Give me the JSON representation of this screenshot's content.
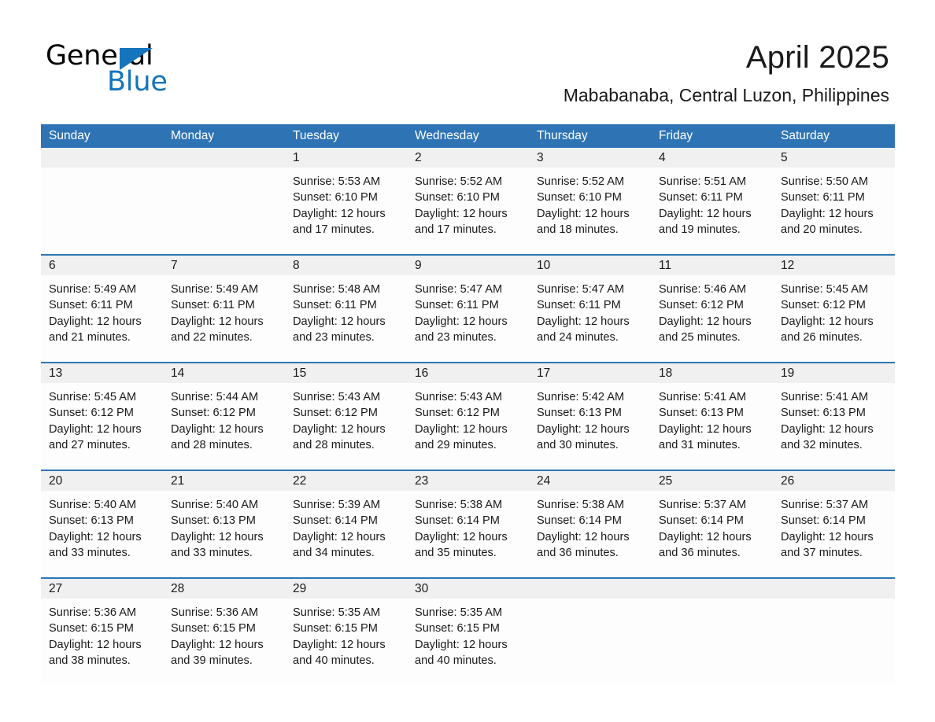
{
  "brand": {
    "name_part1": "General",
    "name_part2": "Blue",
    "triangle_icon": "blue-triangle-icon",
    "colors": {
      "black": "#000000",
      "blue": "#1474bc"
    }
  },
  "header": {
    "title": "April 2025",
    "subtitle": "Mababanaba, Central Luzon, Philippines"
  },
  "theme": {
    "header_blue": "#2e74b5",
    "date_band_gray": "#f0f0f0",
    "cell_background": "#fdfdfd",
    "text_color": "#1a1a1a"
  },
  "weekday_headers": [
    "Sunday",
    "Monday",
    "Tuesday",
    "Wednesday",
    "Thursday",
    "Friday",
    "Saturday"
  ],
  "weeks": [
    {
      "days": [
        {
          "num": "",
          "empty": true,
          "sunrise": "",
          "sunset": "",
          "daylight_1": "",
          "daylight_2": ""
        },
        {
          "num": "",
          "empty": true,
          "sunrise": "",
          "sunset": "",
          "daylight_1": "",
          "daylight_2": ""
        },
        {
          "num": "1",
          "empty": false,
          "sunrise": "Sunrise: 5:53 AM",
          "sunset": "Sunset: 6:10 PM",
          "daylight_1": "Daylight: 12 hours",
          "daylight_2": "and 17 minutes."
        },
        {
          "num": "2",
          "empty": false,
          "sunrise": "Sunrise: 5:52 AM",
          "sunset": "Sunset: 6:10 PM",
          "daylight_1": "Daylight: 12 hours",
          "daylight_2": "and 17 minutes."
        },
        {
          "num": "3",
          "empty": false,
          "sunrise": "Sunrise: 5:52 AM",
          "sunset": "Sunset: 6:10 PM",
          "daylight_1": "Daylight: 12 hours",
          "daylight_2": "and 18 minutes."
        },
        {
          "num": "4",
          "empty": false,
          "sunrise": "Sunrise: 5:51 AM",
          "sunset": "Sunset: 6:11 PM",
          "daylight_1": "Daylight: 12 hours",
          "daylight_2": "and 19 minutes."
        },
        {
          "num": "5",
          "empty": false,
          "sunrise": "Sunrise: 5:50 AM",
          "sunset": "Sunset: 6:11 PM",
          "daylight_1": "Daylight: 12 hours",
          "daylight_2": "and 20 minutes."
        }
      ]
    },
    {
      "days": [
        {
          "num": "6",
          "empty": false,
          "sunrise": "Sunrise: 5:49 AM",
          "sunset": "Sunset: 6:11 PM",
          "daylight_1": "Daylight: 12 hours",
          "daylight_2": "and 21 minutes."
        },
        {
          "num": "7",
          "empty": false,
          "sunrise": "Sunrise: 5:49 AM",
          "sunset": "Sunset: 6:11 PM",
          "daylight_1": "Daylight: 12 hours",
          "daylight_2": "and 22 minutes."
        },
        {
          "num": "8",
          "empty": false,
          "sunrise": "Sunrise: 5:48 AM",
          "sunset": "Sunset: 6:11 PM",
          "daylight_1": "Daylight: 12 hours",
          "daylight_2": "and 23 minutes."
        },
        {
          "num": "9",
          "empty": false,
          "sunrise": "Sunrise: 5:47 AM",
          "sunset": "Sunset: 6:11 PM",
          "daylight_1": "Daylight: 12 hours",
          "daylight_2": "and 23 minutes."
        },
        {
          "num": "10",
          "empty": false,
          "sunrise": "Sunrise: 5:47 AM",
          "sunset": "Sunset: 6:11 PM",
          "daylight_1": "Daylight: 12 hours",
          "daylight_2": "and 24 minutes."
        },
        {
          "num": "11",
          "empty": false,
          "sunrise": "Sunrise: 5:46 AM",
          "sunset": "Sunset: 6:12 PM",
          "daylight_1": "Daylight: 12 hours",
          "daylight_2": "and 25 minutes."
        },
        {
          "num": "12",
          "empty": false,
          "sunrise": "Sunrise: 5:45 AM",
          "sunset": "Sunset: 6:12 PM",
          "daylight_1": "Daylight: 12 hours",
          "daylight_2": "and 26 minutes."
        }
      ]
    },
    {
      "days": [
        {
          "num": "13",
          "empty": false,
          "sunrise": "Sunrise: 5:45 AM",
          "sunset": "Sunset: 6:12 PM",
          "daylight_1": "Daylight: 12 hours",
          "daylight_2": "and 27 minutes."
        },
        {
          "num": "14",
          "empty": false,
          "sunrise": "Sunrise: 5:44 AM",
          "sunset": "Sunset: 6:12 PM",
          "daylight_1": "Daylight: 12 hours",
          "daylight_2": "and 28 minutes."
        },
        {
          "num": "15",
          "empty": false,
          "sunrise": "Sunrise: 5:43 AM",
          "sunset": "Sunset: 6:12 PM",
          "daylight_1": "Daylight: 12 hours",
          "daylight_2": "and 28 minutes."
        },
        {
          "num": "16",
          "empty": false,
          "sunrise": "Sunrise: 5:43 AM",
          "sunset": "Sunset: 6:12 PM",
          "daylight_1": "Daylight: 12 hours",
          "daylight_2": "and 29 minutes."
        },
        {
          "num": "17",
          "empty": false,
          "sunrise": "Sunrise: 5:42 AM",
          "sunset": "Sunset: 6:13 PM",
          "daylight_1": "Daylight: 12 hours",
          "daylight_2": "and 30 minutes."
        },
        {
          "num": "18",
          "empty": false,
          "sunrise": "Sunrise: 5:41 AM",
          "sunset": "Sunset: 6:13 PM",
          "daylight_1": "Daylight: 12 hours",
          "daylight_2": "and 31 minutes."
        },
        {
          "num": "19",
          "empty": false,
          "sunrise": "Sunrise: 5:41 AM",
          "sunset": "Sunset: 6:13 PM",
          "daylight_1": "Daylight: 12 hours",
          "daylight_2": "and 32 minutes."
        }
      ]
    },
    {
      "days": [
        {
          "num": "20",
          "empty": false,
          "sunrise": "Sunrise: 5:40 AM",
          "sunset": "Sunset: 6:13 PM",
          "daylight_1": "Daylight: 12 hours",
          "daylight_2": "and 33 minutes."
        },
        {
          "num": "21",
          "empty": false,
          "sunrise": "Sunrise: 5:40 AM",
          "sunset": "Sunset: 6:13 PM",
          "daylight_1": "Daylight: 12 hours",
          "daylight_2": "and 33 minutes."
        },
        {
          "num": "22",
          "empty": false,
          "sunrise": "Sunrise: 5:39 AM",
          "sunset": "Sunset: 6:14 PM",
          "daylight_1": "Daylight: 12 hours",
          "daylight_2": "and 34 minutes."
        },
        {
          "num": "23",
          "empty": false,
          "sunrise": "Sunrise: 5:38 AM",
          "sunset": "Sunset: 6:14 PM",
          "daylight_1": "Daylight: 12 hours",
          "daylight_2": "and 35 minutes."
        },
        {
          "num": "24",
          "empty": false,
          "sunrise": "Sunrise: 5:38 AM",
          "sunset": "Sunset: 6:14 PM",
          "daylight_1": "Daylight: 12 hours",
          "daylight_2": "and 36 minutes."
        },
        {
          "num": "25",
          "empty": false,
          "sunrise": "Sunrise: 5:37 AM",
          "sunset": "Sunset: 6:14 PM",
          "daylight_1": "Daylight: 12 hours",
          "daylight_2": "and 36 minutes."
        },
        {
          "num": "26",
          "empty": false,
          "sunrise": "Sunrise: 5:37 AM",
          "sunset": "Sunset: 6:14 PM",
          "daylight_1": "Daylight: 12 hours",
          "daylight_2": "and 37 minutes."
        }
      ]
    },
    {
      "days": [
        {
          "num": "27",
          "empty": false,
          "sunrise": "Sunrise: 5:36 AM",
          "sunset": "Sunset: 6:15 PM",
          "daylight_1": "Daylight: 12 hours",
          "daylight_2": "and 38 minutes."
        },
        {
          "num": "28",
          "empty": false,
          "sunrise": "Sunrise: 5:36 AM",
          "sunset": "Sunset: 6:15 PM",
          "daylight_1": "Daylight: 12 hours",
          "daylight_2": "and 39 minutes."
        },
        {
          "num": "29",
          "empty": false,
          "sunrise": "Sunrise: 5:35 AM",
          "sunset": "Sunset: 6:15 PM",
          "daylight_1": "Daylight: 12 hours",
          "daylight_2": "and 40 minutes."
        },
        {
          "num": "30",
          "empty": false,
          "sunrise": "Sunrise: 5:35 AM",
          "sunset": "Sunset: 6:15 PM",
          "daylight_1": "Daylight: 12 hours",
          "daylight_2": "and 40 minutes."
        },
        {
          "num": "",
          "empty": true,
          "sunrise": "",
          "sunset": "",
          "daylight_1": "",
          "daylight_2": ""
        },
        {
          "num": "",
          "empty": true,
          "sunrise": "",
          "sunset": "",
          "daylight_1": "",
          "daylight_2": ""
        },
        {
          "num": "",
          "empty": true,
          "sunrise": "",
          "sunset": "",
          "daylight_1": "",
          "daylight_2": ""
        }
      ]
    }
  ]
}
